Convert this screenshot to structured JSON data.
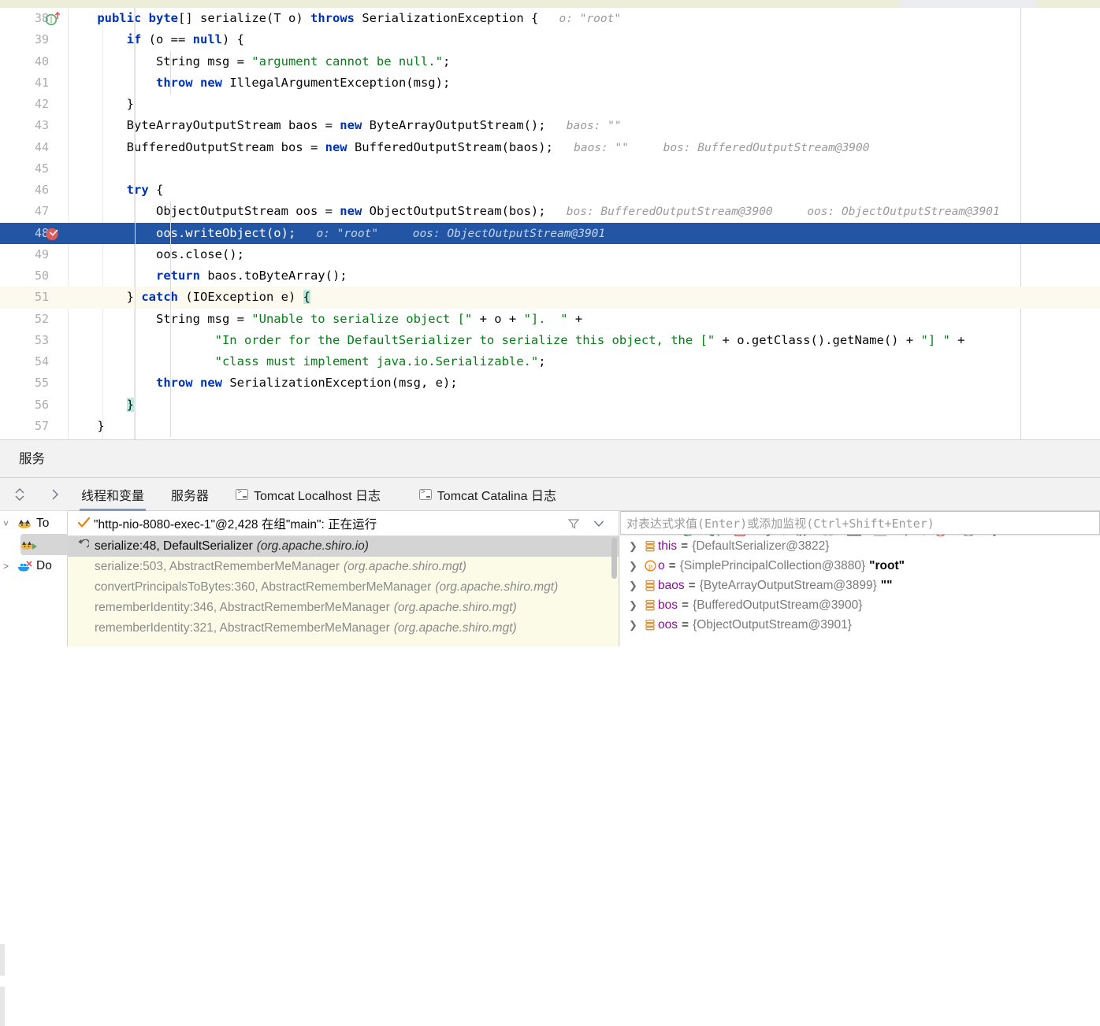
{
  "editor": {
    "lines": [
      {
        "num": "38",
        "gutter": "implementing-method-icon",
        "indent": 0,
        "tokens": [
          {
            "t": "    ",
            "c": "plain"
          },
          {
            "t": "public",
            "c": "kw"
          },
          {
            "t": " ",
            "c": "plain"
          },
          {
            "t": "byte",
            "c": "kw"
          },
          {
            "t": "[] ",
            "c": "plain"
          },
          {
            "t": "serialize",
            "c": "fn-decl"
          },
          {
            "t": "(",
            "c": "plain"
          },
          {
            "t": "T",
            "c": "type-t"
          },
          {
            "t": " o) ",
            "c": "plain"
          },
          {
            "t": "throws",
            "c": "kw"
          },
          {
            "t": " SerializationException {",
            "c": "plain"
          }
        ],
        "hint": "o: \"root\"",
        "hint_gap": 30
      },
      {
        "num": "39",
        "gutter": "",
        "indent": 0,
        "tokens": [
          {
            "t": "        ",
            "c": "plain"
          },
          {
            "t": "if",
            "c": "kw"
          },
          {
            "t": " (o == ",
            "c": "plain"
          },
          {
            "t": "null",
            "c": "kw"
          },
          {
            "t": ") {",
            "c": "plain"
          }
        ],
        "hint": ""
      },
      {
        "num": "40",
        "gutter": "",
        "indent": 0,
        "tokens": [
          {
            "t": "            String msg = ",
            "c": "plain"
          },
          {
            "t": "\"argument cannot be null.\"",
            "c": "str"
          },
          {
            "t": ";",
            "c": "plain"
          }
        ],
        "hint": ""
      },
      {
        "num": "41",
        "gutter": "",
        "indent": 0,
        "tokens": [
          {
            "t": "            ",
            "c": "plain"
          },
          {
            "t": "throw",
            "c": "kw"
          },
          {
            "t": " ",
            "c": "plain"
          },
          {
            "t": "new",
            "c": "kw"
          },
          {
            "t": " IllegalArgumentException(msg);",
            "c": "plain"
          }
        ],
        "hint": ""
      },
      {
        "num": "42",
        "gutter": "",
        "indent": 0,
        "tokens": [
          {
            "t": "        }",
            "c": "plain"
          }
        ],
        "hint": ""
      },
      {
        "num": "43",
        "gutter": "",
        "indent": 0,
        "tokens": [
          {
            "t": "        ByteArrayOutputStream baos = ",
            "c": "plain"
          },
          {
            "t": "new",
            "c": "kw"
          },
          {
            "t": " ByteArrayOutputStream();",
            "c": "plain"
          }
        ],
        "hint": "baos: \"\"",
        "hint_gap": 16
      },
      {
        "num": "44",
        "gutter": "",
        "indent": 0,
        "tokens": [
          {
            "t": "        BufferedOutputStream bos = ",
            "c": "plain"
          },
          {
            "t": "new",
            "c": "kw"
          },
          {
            "t": " BufferedOutputStream(baos);",
            "c": "plain"
          }
        ],
        "hint": "baos: \"\"",
        "hint2": "bos: BufferedOutputStream@3900",
        "hint_gap": 16
      },
      {
        "num": "45",
        "gutter": "",
        "indent": 0,
        "tokens": [],
        "hint": ""
      },
      {
        "num": "46",
        "gutter": "",
        "indent": 0,
        "tokens": [
          {
            "t": "        ",
            "c": "plain"
          },
          {
            "t": "try",
            "c": "kw"
          },
          {
            "t": " {",
            "c": "plain"
          }
        ],
        "hint": ""
      },
      {
        "num": "47",
        "gutter": "",
        "indent": 0,
        "tokens": [
          {
            "t": "            ObjectOutputStream oos = ",
            "c": "plain"
          },
          {
            "t": "new",
            "c": "kw"
          },
          {
            "t": " ObjectOutputStream(bos);",
            "c": "plain"
          }
        ],
        "hint": "bos: BufferedOutputStream@3900",
        "hint2": "oos: ObjectOutputStream@3901",
        "hint_gap": 16
      },
      {
        "num": "48",
        "gutter": "breakpoint-verified-icon",
        "indent": 0,
        "current": true,
        "tokens": [
          {
            "t": "            oos.writeObject(o);",
            "c": "plain"
          }
        ],
        "hint": "o: \"root\"",
        "hint2": "oos: ObjectOutputStream@3901",
        "hint_gap": 16
      },
      {
        "num": "49",
        "gutter": "",
        "indent": 0,
        "tokens": [
          {
            "t": "            oos.close();",
            "c": "plain"
          }
        ],
        "hint": ""
      },
      {
        "num": "50",
        "gutter": "",
        "indent": 0,
        "tokens": [
          {
            "t": "            ",
            "c": "plain"
          },
          {
            "t": "return",
            "c": "kw"
          },
          {
            "t": " baos.toByteArray();",
            "c": "plain"
          }
        ],
        "hint": ""
      },
      {
        "num": "51",
        "gutter": "",
        "indent": 0,
        "cream": true,
        "tokens": [
          {
            "t": "        } ",
            "c": "plain"
          },
          {
            "t": "catch",
            "c": "kw"
          },
          {
            "t": " (IOException e) ",
            "c": "plain"
          },
          {
            "t": "{",
            "c": "brace"
          }
        ],
        "hint": ""
      },
      {
        "num": "52",
        "gutter": "",
        "indent": 0,
        "tokens": [
          {
            "t": "            String msg = ",
            "c": "plain"
          },
          {
            "t": "\"Unable to serialize object [\"",
            "c": "str"
          },
          {
            "t": " + o + ",
            "c": "plain"
          },
          {
            "t": "\"].  \"",
            "c": "str"
          },
          {
            "t": " +",
            "c": "plain"
          }
        ],
        "hint": ""
      },
      {
        "num": "53",
        "gutter": "",
        "indent": 0,
        "tokens": [
          {
            "t": "                    ",
            "c": "plain"
          },
          {
            "t": "\"In order for the DefaultSerializer to serialize this object, the [\"",
            "c": "str"
          },
          {
            "t": " + o.getClass().getName() + ",
            "c": "plain"
          },
          {
            "t": "\"] \"",
            "c": "str"
          },
          {
            "t": " +",
            "c": "plain"
          }
        ],
        "hint": ""
      },
      {
        "num": "54",
        "gutter": "",
        "indent": 0,
        "tokens": [
          {
            "t": "                    ",
            "c": "plain"
          },
          {
            "t": "\"class must implement java.io.Serializable.\"",
            "c": "str"
          },
          {
            "t": ";",
            "c": "plain"
          }
        ],
        "hint": ""
      },
      {
        "num": "55",
        "gutter": "",
        "indent": 0,
        "tokens": [
          {
            "t": "            ",
            "c": "plain"
          },
          {
            "t": "throw",
            "c": "kw"
          },
          {
            "t": " ",
            "c": "plain"
          },
          {
            "t": "new",
            "c": "kw"
          },
          {
            "t": " SerializationException(msg, e);",
            "c": "plain"
          }
        ],
        "hint": ""
      },
      {
        "num": "56",
        "gutter": "",
        "indent": 0,
        "tokens": [
          {
            "t": "        ",
            "c": "plain"
          },
          {
            "t": "}",
            "c": "brace"
          }
        ],
        "hint": ""
      },
      {
        "num": "57",
        "gutter": "",
        "indent": 0,
        "tokens": [
          {
            "t": "    }",
            "c": "plain"
          }
        ],
        "hint": ""
      }
    ]
  },
  "services": {
    "title": "服务",
    "tree": {
      "items": [
        {
          "label": "To",
          "icon": "tomcat-icon",
          "expanded": true,
          "level": 0
        },
        {
          "label": "",
          "icon": "tomcat-run-icon",
          "expanded": false,
          "level": 1,
          "selected": true
        },
        {
          "label": "Do",
          "icon": "docker-icon",
          "expanded": false,
          "level": 0
        }
      ]
    },
    "tabs": [
      {
        "label": "线程和变量",
        "icon": "",
        "active": true
      },
      {
        "label": "服务器",
        "icon": "",
        "active": false
      },
      {
        "label": "Tomcat Localhost 日志",
        "icon": "terminal-icon",
        "active": false
      },
      {
        "label": "Tomcat Catalina 日志",
        "icon": "terminal-icon",
        "active": false
      }
    ],
    "toolbar": [
      {
        "name": "rerun-button",
        "icon": "rerun-icon"
      },
      {
        "name": "rerun-debug-button",
        "icon": "rerun-debug-icon"
      },
      {
        "name": "stop-button",
        "icon": "stop-icon"
      },
      {
        "name": "restart-button",
        "icon": "restart-icon"
      },
      {
        "name": "sep",
        "icon": "separator"
      },
      {
        "name": "resume-button",
        "icon": "resume-icon"
      },
      {
        "name": "pause-button",
        "icon": "pause-icon"
      },
      {
        "name": "step-over-button",
        "icon": "step-over-icon"
      },
      {
        "name": "step-into-button",
        "icon": "step-into-icon"
      },
      {
        "name": "step-out-button",
        "icon": "step-out-icon"
      },
      {
        "name": "sep2",
        "icon": "separator"
      },
      {
        "name": "mute-breakpoints-button",
        "icon": "mute-breakpoints-icon"
      },
      {
        "name": "view-breakpoints-button",
        "icon": "no-breakpoints-icon"
      },
      {
        "name": "more-button",
        "icon": "more-vertical-icon"
      }
    ],
    "thread": {
      "label": "\"http-nio-8080-exec-1\"@2,428 在组\"main\": 正在运行",
      "status_icon": "running-check-icon"
    },
    "expression": {
      "placeholder": "对表达式求值(Enter)或添加监视(Ctrl+Shift+Enter)",
      "value": ""
    },
    "frames": [
      {
        "method": "serialize:48, DefaultSerializer",
        "pkg": "(org.apache.shiro.io)",
        "selected": true,
        "icon": "return-arrow-icon"
      },
      {
        "method": "serialize:503, AbstractRememberMeManager",
        "pkg": "(org.apache.shiro.mgt)",
        "selected": false,
        "icon": ""
      },
      {
        "method": "convertPrincipalsToBytes:360, AbstractRememberMeManager",
        "pkg": "(org.apache.shiro.mgt)",
        "selected": false,
        "icon": ""
      },
      {
        "method": "rememberIdentity:346, AbstractRememberMeManager",
        "pkg": "(org.apache.shiro.mgt)",
        "selected": false,
        "icon": ""
      },
      {
        "method": "rememberIdentity:321, AbstractRememberMeManager",
        "pkg": "(org.apache.shiro.mgt)",
        "selected": false,
        "icon": ""
      }
    ],
    "variables": [
      {
        "name": "this",
        "value": "{DefaultSerializer@3822}",
        "str": "",
        "icon": "object-icon"
      },
      {
        "name": "o",
        "value": "{SimplePrincipalCollection@3880}",
        "str": "\"root\"",
        "icon": "parameter-icon"
      },
      {
        "name": "baos",
        "value": "{ByteArrayOutputStream@3899}",
        "str": "\"\"",
        "icon": "object-icon"
      },
      {
        "name": "bos",
        "value": "{BufferedOutputStream@3900}",
        "str": "",
        "icon": "object-icon"
      },
      {
        "name": "oos",
        "value": "{ObjectOutputStream@3901}",
        "str": "",
        "icon": "object-icon"
      }
    ]
  },
  "colors": {
    "current_line": "#2255a4",
    "cream_line": "#fcfaee",
    "keyword": "#0033b3",
    "string": "#067d17",
    "hint": "#9a9a9a",
    "frames_bg": "#fbfbe8",
    "var_name": "#871094",
    "breakpoint": "#db5c5c"
  }
}
